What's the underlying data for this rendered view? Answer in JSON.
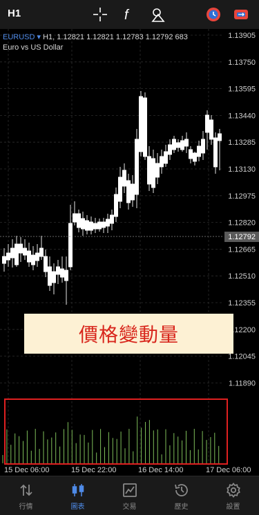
{
  "toolbar": {
    "timeframe": "H1",
    "icons": [
      "crosshair-icon",
      "function-icon",
      "objects-icon",
      "trade-clock-icon",
      "account-switch-icon"
    ]
  },
  "symbol": {
    "name": "EURUSD",
    "arrow": "▾",
    "info": "H1, 1.12821 1.12821 1.12783 1.12792 683",
    "description": "Euro vs US Dollar"
  },
  "price_axis": {
    "labels": [
      "1.13905",
      "1.13750",
      "1.13595",
      "1.13440",
      "1.13285",
      "1.13130",
      "1.12975",
      "1.12820",
      "1.12665",
      "1.12510",
      "1.12355",
      "1.12200",
      "1.12045",
      "1.11890"
    ],
    "current_price": "1.12792"
  },
  "time_axis": {
    "labels": [
      "15 Dec 06:00",
      "15 Dec 22:00",
      "16 Dec 14:00",
      "17 Dec 06:00"
    ]
  },
  "banner": {
    "text": "價格變動量"
  },
  "colors": {
    "accent": "#4f8be8",
    "highlight_red": "#e02020",
    "banner_bg": "#fdf1d4",
    "banner_text": "#d8261c"
  },
  "tabs": [
    {
      "label": "行情",
      "icon": "quotes-icon",
      "active": false
    },
    {
      "label": "圖表",
      "icon": "chart-icon",
      "active": true
    },
    {
      "label": "交易",
      "icon": "trade-icon",
      "active": false
    },
    {
      "label": "歷史",
      "icon": "history-icon",
      "active": false
    },
    {
      "label": "設置",
      "icon": "settings-icon",
      "active": false
    }
  ]
}
